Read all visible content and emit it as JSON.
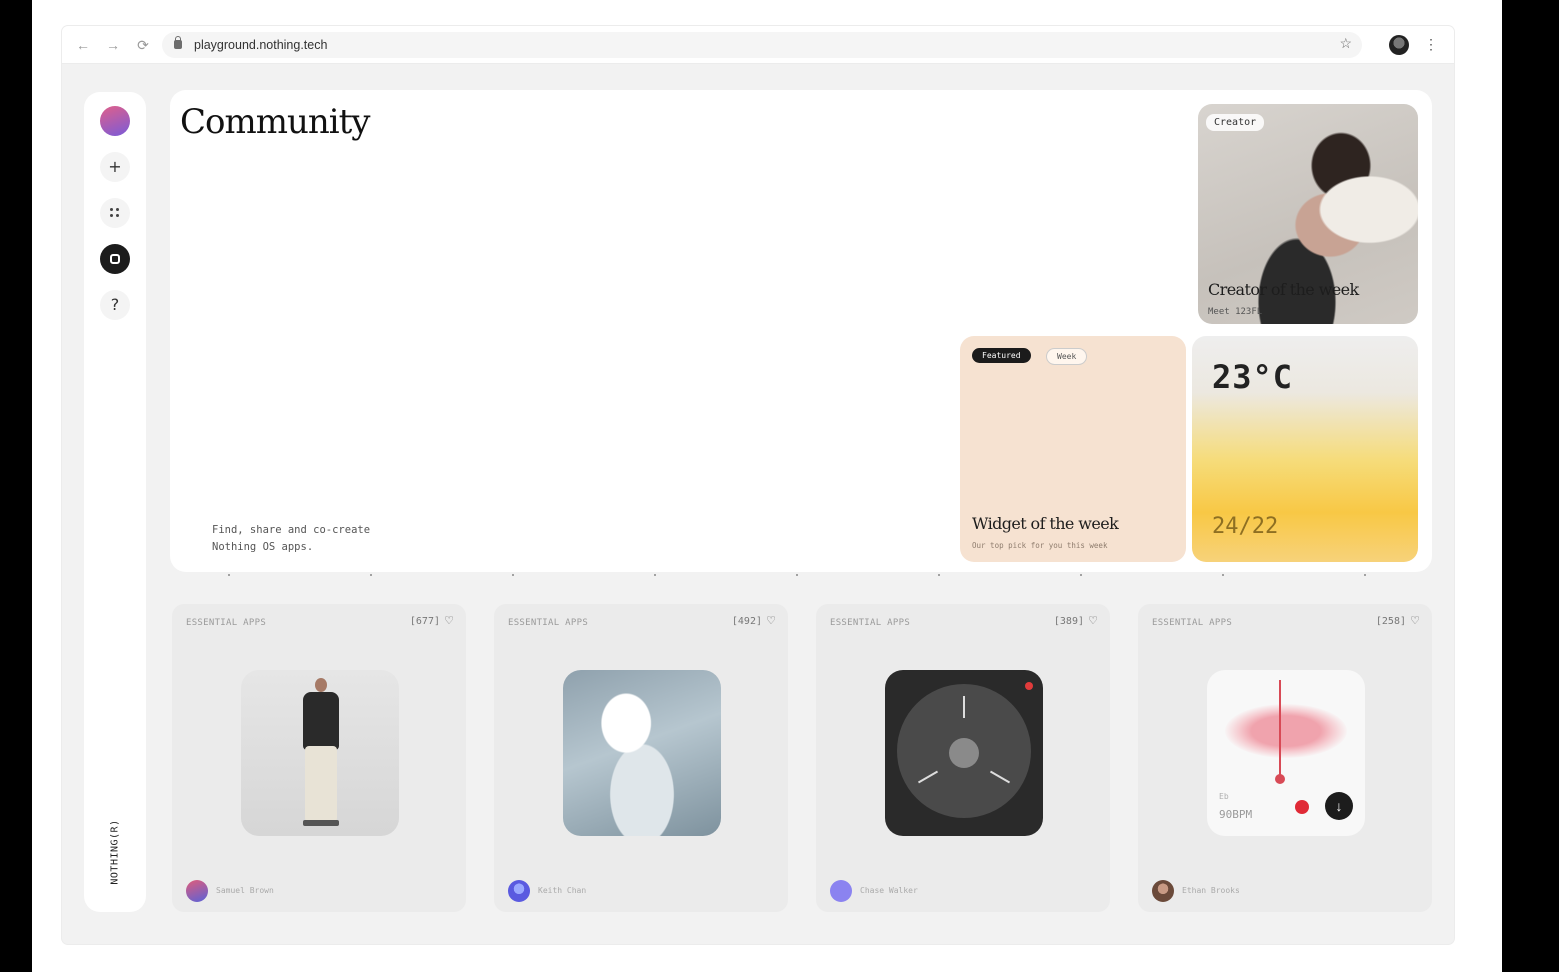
{
  "browser": {
    "url": "playground.nothing.tech",
    "back_icon": "←",
    "forward_icon": "→",
    "reload_icon": "⟳",
    "star_icon": "☆",
    "menu_icon": "⋮"
  },
  "sidebar": {
    "add_icon": "+",
    "help_icon": "?",
    "brand": "NOTHING(R)"
  },
  "hero": {
    "title": "Community",
    "tagline_line1": "Find, share and co-create",
    "tagline_line2": "Nothing OS apps.",
    "creator": {
      "pill": "Creator",
      "title": "Creator of the week",
      "subtitle": "Meet 123FL"
    },
    "widget": {
      "pill_featured": "Featured",
      "pill_week": "Week",
      "title": "Widget of the week",
      "subtitle": "Our top pick for you this week"
    },
    "weather": {
      "temp": "23°C",
      "range": "24/22"
    }
  },
  "apps": [
    {
      "category": "ESSENTIAL APPS",
      "count": "[677]",
      "user": "Samuel Brown"
    },
    {
      "category": "ESSENTIAL APPS",
      "count": "[492]",
      "user": "Keith Chan"
    },
    {
      "category": "ESSENTIAL APPS",
      "count": "[389]",
      "user": "Chase Walker"
    },
    {
      "category": "ESSENTIAL APPS",
      "count": "[258]",
      "user": "Ethan Brooks"
    }
  ],
  "audio_widget": {
    "key": "Eb",
    "bpm": "90BPM",
    "download_icon": "↓"
  },
  "colors": {
    "accent_red": "#e02a36",
    "widget_peach": "#f6e2d1",
    "weather_yellow": "#f8c845"
  },
  "icons": {
    "heart": "♡"
  }
}
